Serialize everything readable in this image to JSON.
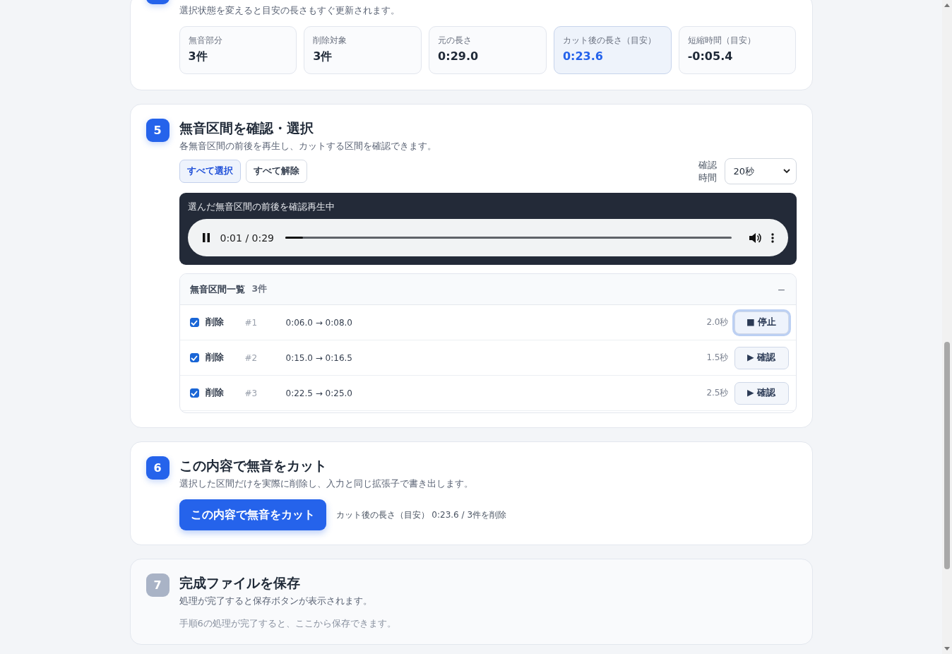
{
  "summary": {
    "description": "選択状態を変えると目安の長さもすぐ更新されます。",
    "stats": [
      {
        "label": "無音部分",
        "value": "3件",
        "highlighted": false
      },
      {
        "label": "削除対象",
        "value": "3件",
        "highlighted": false
      },
      {
        "label": "元の長さ",
        "value": "0:29.0",
        "highlighted": false
      },
      {
        "label": "カット後の長さ（目安）",
        "value": "0:23.6",
        "highlighted": true
      },
      {
        "label": "短縮時間（目安）",
        "value": "-0:05.4",
        "highlighted": false
      }
    ]
  },
  "review": {
    "step": "5",
    "title": "無音区間を確認・選択",
    "description": "各無音区間の前後を再生し、カットする区間を確認できます。",
    "buttons": [
      {
        "label": "すべて選択",
        "selected": true
      },
      {
        "label": "すべて解除",
        "selected": false
      }
    ],
    "duration_label": "確認時間",
    "duration_value": "20秒",
    "player": {
      "caption": "選んだ無音区間の前後を確認再生中",
      "time": "0:01 / 0:29",
      "level": 0.04
    },
    "list": {
      "title": "無音区間一覧",
      "count": "3件",
      "collapse": "−",
      "rows": [
        {
          "checked": true,
          "action": "削除",
          "index": "#1",
          "range": "0:06.0 → 0:08.0",
          "length": "2.0秒",
          "button": "■ 停止",
          "playing": true
        },
        {
          "checked": true,
          "action": "削除",
          "index": "#2",
          "range": "0:15.0 → 0:16.5",
          "length": "1.5秒",
          "button": "▶ 確認",
          "playing": false
        },
        {
          "checked": true,
          "action": "削除",
          "index": "#3",
          "range": "0:22.5 → 0:25.0",
          "length": "2.5秒",
          "button": "▶ 確認",
          "playing": false
        }
      ]
    }
  },
  "cut": {
    "step": "6",
    "title": "この内容で無音をカット",
    "description": "選択した区間だけを実際に削除し、入力と同じ拡張子で書き出します。",
    "button": "この内容で無音をカット",
    "note": "カット後の長さ（目安） 0:23.6 / 3件を削除",
    "disabled": false
  },
  "save": {
    "step": "7",
    "title": "完成ファイルを保存",
    "description": "処理が完了すると保存ボタンが表示されます。",
    "note": "手順6の処理が完了すると、ここから保存できます。",
    "disabled": true
  }
}
